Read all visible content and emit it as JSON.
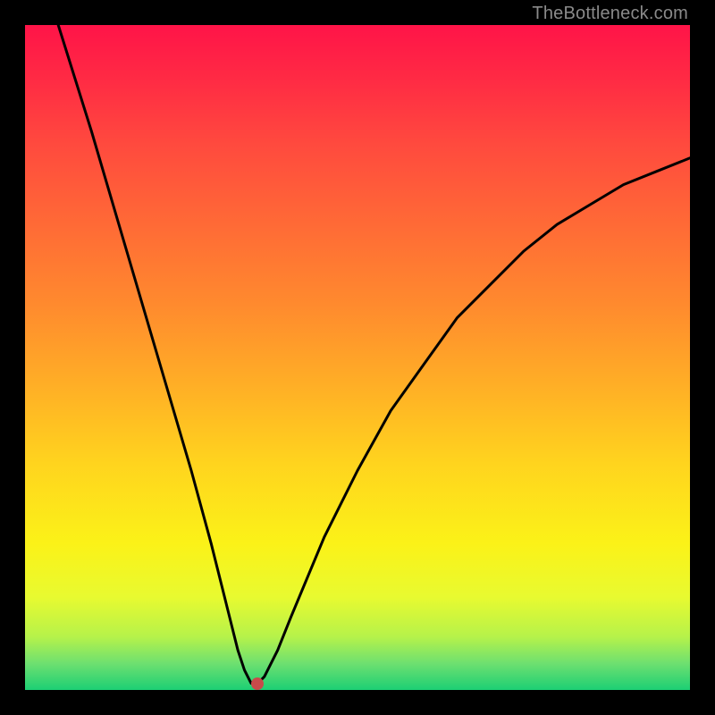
{
  "watermark": "TheBottleneck.com",
  "chart_data": {
    "type": "line",
    "title": "",
    "xlabel": "",
    "ylabel": "",
    "xlim": [
      0,
      100
    ],
    "ylim": [
      0,
      100
    ],
    "series": [
      {
        "name": "bottleneck-curve",
        "x": [
          5,
          10,
          15,
          20,
          25,
          28,
          30,
          32,
          33,
          34,
          35,
          36,
          38,
          40,
          45,
          50,
          55,
          60,
          65,
          70,
          75,
          80,
          85,
          90,
          95,
          100
        ],
        "values": [
          100,
          84,
          67,
          50,
          33,
          22,
          14,
          6,
          3,
          1,
          1,
          2,
          6,
          11,
          23,
          33,
          42,
          49,
          56,
          61,
          66,
          70,
          73,
          76,
          78,
          80
        ]
      }
    ],
    "annotations": [
      {
        "name": "optimal-marker",
        "x": 35,
        "y": 1
      }
    ],
    "background_gradient": {
      "stops": [
        {
          "pos": 0,
          "color": "#ff1448"
        },
        {
          "pos": 50,
          "color": "#ff8a2e"
        },
        {
          "pos": 78,
          "color": "#fbf218"
        },
        {
          "pos": 100,
          "color": "#1ccf74"
        }
      ]
    }
  }
}
